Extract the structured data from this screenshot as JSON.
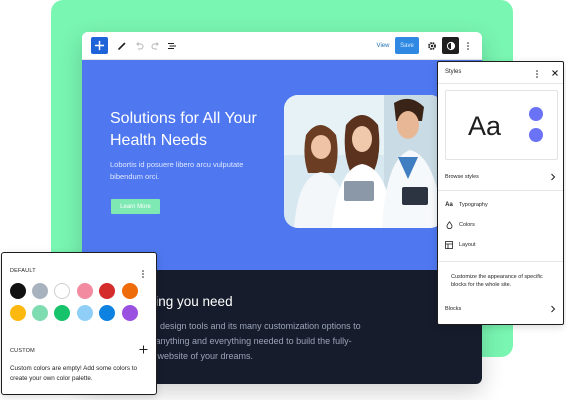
{
  "toolbar": {
    "add_icon": "plus-icon",
    "tools": [
      "pen-icon",
      "undo-icon",
      "redo-icon",
      "list-view-icon"
    ],
    "view_label": "View",
    "save_label": "Save",
    "settings_icon": "gear-icon",
    "styles_icon": "half-circle-icon",
    "more_icon": "vertical-ellipsis-icon"
  },
  "hero": {
    "title": "Solutions for All Your Health Needs",
    "text": "Lobortis id posuere libero arcu vulputate bibendum orci.",
    "button_label": "Learn More",
    "background": "#4f78f0",
    "button_color": "#7fe9b4"
  },
  "dark_section": {
    "title_visible": "thing you need",
    "text_lines": [
      "ve design tools and its many customization options to",
      "e anything and everything needed to build the fully-",
      "al website of your dreams."
    ],
    "background": "#161c2c"
  },
  "styles_panel": {
    "title": "Styles",
    "preview_text": "Aa",
    "preview_dot_color": "#6a72f5",
    "browse_label": "Browse styles",
    "items": [
      {
        "icon": "typography-icon",
        "icon_text": "Aa",
        "label": "Typography"
      },
      {
        "icon": "droplet-icon",
        "label": "Colors"
      },
      {
        "icon": "layout-icon",
        "label": "Layout"
      }
    ],
    "description": "Customize the appearance of specific blocks for the whole site.",
    "blocks_label": "Blocks"
  },
  "palette": {
    "default_label": "DEFAULT",
    "colors": [
      "#111111",
      "#a8b2bf",
      "#ffffff",
      "#f38ba0",
      "#d42b2b",
      "#ef6c0a",
      "#fcb80e",
      "#7fdcb0",
      "#16c26a",
      "#8fcff7",
      "#0d82e0",
      "#9b51e0"
    ],
    "custom_label": "CUSTOM",
    "custom_text": "Custom colors are empty! Add some colors to create your own color palette."
  }
}
